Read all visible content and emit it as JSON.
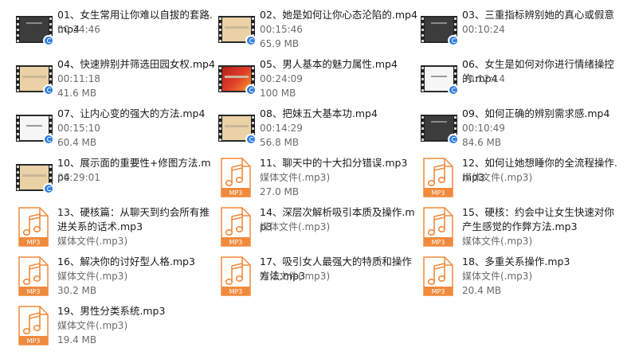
{
  "files": [
    {
      "name": "01、女生常用让你难以自拔的套路.mp4",
      "duration": "00:34:46",
      "kind": "video",
      "thumb": "dark"
    },
    {
      "name": "02、她是如何让你心态沦陷的.mp4",
      "duration": "00:15:46",
      "size": "65.9 MB",
      "kind": "video",
      "thumb": "beige"
    },
    {
      "name": "03、三重指标辨别她的真心或假意",
      "duration": "00:10:24",
      "kind": "video",
      "thumb": "dark"
    },
    {
      "name": "04、快速辨别并筛选田园女权.mp4",
      "duration": "00:11:18",
      "size": "41.6 MB",
      "kind": "video",
      "thumb": "beige"
    },
    {
      "name": "05、男人基本的魅力属性.mp4",
      "duration": "00:24:09",
      "size": "100 MB",
      "kind": "video",
      "thumb": "red"
    },
    {
      "name": "06、女生是如何对你进行情绪操控的.mp4",
      "duration": "00:12:14",
      "kind": "video",
      "thumb": "white"
    },
    {
      "name": "07、让内心变的强大的方法.mp4",
      "duration": "00:15:10",
      "size": "60.4 MB",
      "kind": "video",
      "thumb": "white"
    },
    {
      "name": "08、把妹五大基本功.mp4",
      "duration": "00:14:29",
      "size": "56.8 MB",
      "kind": "video",
      "thumb": "beige"
    },
    {
      "name": "09、如何正确的辨别需求感.mp4",
      "duration": "00:10:49",
      "size": "84.6 MB",
      "kind": "video",
      "thumb": "dark"
    },
    {
      "name": "10、展示面的重要性+修图方法.mp4",
      "duration": "00:29:01",
      "kind": "video",
      "thumb": "beige"
    },
    {
      "name": "11、聊天中的十大扣分错误.mp3",
      "type_label": "媒体文件(.mp3)",
      "size": "27.0 MB",
      "kind": "audio"
    },
    {
      "name": "12、如何让她想睡你的全流程操作.mp3",
      "type_label": "媒体文件(.mp3)",
      "kind": "audio"
    },
    {
      "name": "13、硬核篇：从聊天到约会所有推进关系的话术.mp3",
      "type_label": "媒体文件(.mp3)",
      "kind": "audio"
    },
    {
      "name": "14、深层次解析吸引本质及操作.mp3",
      "type_label": "媒体文件(.mp3)",
      "kind": "audio"
    },
    {
      "name": "15、硬核：约会中让女生快速对你产生感觉的作弊方法.mp3",
      "type_label": "媒体文件(.mp3)",
      "kind": "audio"
    },
    {
      "name": "16、解决你的讨好型人格.mp3",
      "type_label": "媒体文件(.mp3)",
      "size": "30.2 MB",
      "kind": "audio"
    },
    {
      "name": "17、吸引女人最强大的特质和操作方法.mp3",
      "type_label": "媒体文件(.mp3)",
      "kind": "audio"
    },
    {
      "name": "18、多重关系操作.mp3",
      "type_label": "媒体文件(.mp3)",
      "size": "20.4 MB",
      "kind": "audio"
    },
    {
      "name": "19、男性分类系统.mp3",
      "type_label": "媒体文件(.mp3)",
      "size": "19.4 MB",
      "kind": "audio"
    }
  ],
  "icons": {
    "video_badge": "refresh-badge-icon",
    "audio": "mp3-file-icon"
  },
  "colors": {
    "accent": "#2f7ee0",
    "mp3_orange": "#f08a3c",
    "meta_text": "#6b6b6b"
  },
  "audio_badge_text": "MP3"
}
